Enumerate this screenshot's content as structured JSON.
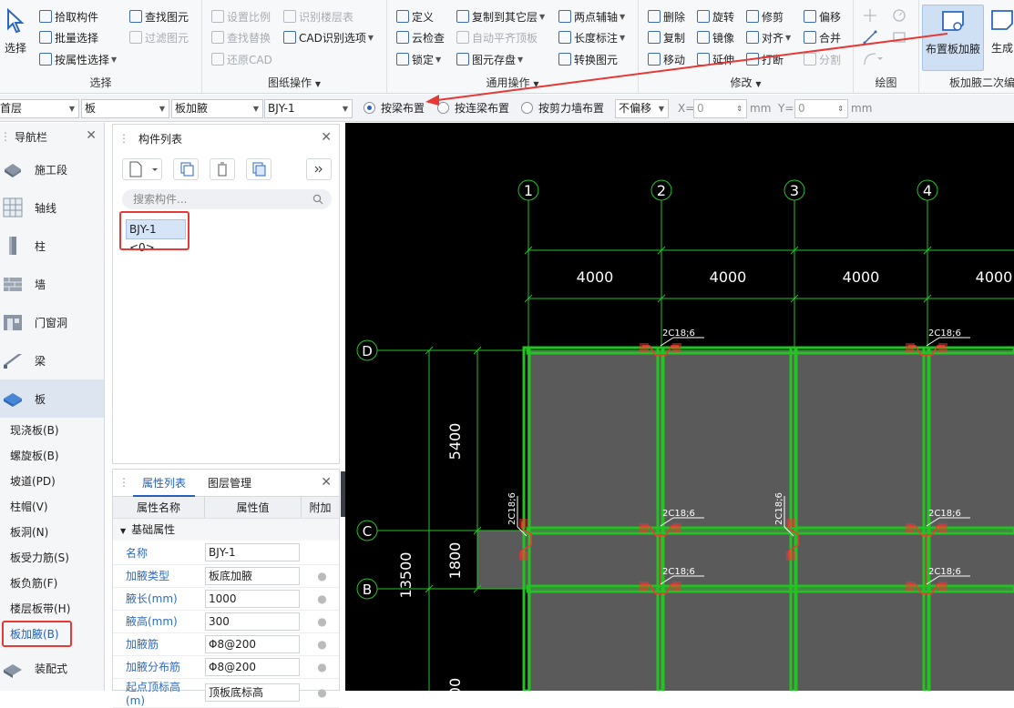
{
  "ribbon": {
    "select": {
      "label": "选择",
      "pick": "拾取构件",
      "batch": "批量选择",
      "by_attr": "按属性选择",
      "find": "查找图元",
      "filter": "过滤图元",
      "group": "选择"
    },
    "drawing_ops": {
      "set_scale": "设置比例",
      "recognize_floor_table": "识别楼层表",
      "find_replace": "查找替换",
      "cad_options": "CAD识别选项",
      "restore_cad": "还原CAD",
      "group": "图纸操作"
    },
    "general_ops": {
      "define": "定义",
      "copy_to_floor": "复制到其它层",
      "two_point_axis": "两点辅轴",
      "cloud_check": "云检查",
      "auto_align_slab": "自动平齐顶板",
      "length_dim": "长度标注",
      "lock": "锁定",
      "save_elements": "图元存盘",
      "convert_elements": "转换图元",
      "group": "通用操作"
    },
    "modify": {
      "delete": "删除",
      "rotate": "旋转",
      "trim": "修剪",
      "offset": "偏移",
      "copy": "复制",
      "mirror": "镜像",
      "align": "对齐",
      "merge": "合并",
      "move": "移动",
      "extend": "延伸",
      "break": "打断",
      "split": "分割",
      "group": "修改"
    },
    "draw": {
      "group": "绘图"
    },
    "haunch": {
      "place": "布置板加腋",
      "generate": "生成",
      "group": "板加腋二次编"
    }
  },
  "optbar": {
    "floor": "首层",
    "category": "板",
    "type": "板加腋",
    "element": "BJY-1",
    "radio1": "按梁布置",
    "radio2": "按连梁布置",
    "radio3": "按剪力墙布置",
    "offset": "不偏移",
    "x_label": "X=",
    "x_value": "0",
    "y_label": "Y=",
    "y_value": "0",
    "unit": "mm"
  },
  "nav": {
    "title": "导航栏",
    "items": [
      {
        "label": "施工段"
      },
      {
        "label": "轴线"
      },
      {
        "label": "柱"
      },
      {
        "label": "墙"
      },
      {
        "label": "门窗洞"
      },
      {
        "label": "梁"
      },
      {
        "label": "板"
      }
    ],
    "subitems": [
      "现浇板(B)",
      "螺旋板(B)",
      "坡道(PD)",
      "柱帽(V)",
      "板洞(N)",
      "板受力筋(S)",
      "板负筋(F)",
      "楼层板带(H)",
      "板加腋(B)"
    ],
    "bottom_item": "装配式"
  },
  "complist": {
    "title": "构件列表",
    "search_placeholder": "搜索构件...",
    "item": "BJY-1 <0>"
  },
  "props": {
    "tab1": "属性列表",
    "tab2": "图层管理",
    "col_name": "属性名称",
    "col_value": "属性值",
    "col_extra": "附加",
    "section": "基础属性",
    "rows": [
      {
        "name": "名称",
        "value": "BJY-1"
      },
      {
        "name": "加腋类型",
        "value": "板底加腋"
      },
      {
        "name": "腋长(mm)",
        "value": "1000"
      },
      {
        "name": "腋高(mm)",
        "value": "300"
      },
      {
        "name": "加腋筋",
        "value": "Φ8@200"
      },
      {
        "name": "加腋分布筋",
        "value": "Φ8@200"
      },
      {
        "name": "起点顶标高(m)",
        "value": "顶板底标高"
      }
    ]
  },
  "cad": {
    "axes_x": [
      "1",
      "2",
      "3",
      "4"
    ],
    "axes_y": [
      "D",
      "C",
      "B"
    ],
    "spans_x": [
      "4000",
      "4000",
      "4000",
      "4000"
    ],
    "span_y1": "5400",
    "span_y2": "1800",
    "total_y": "13500",
    "rebar_label": "2C18;6",
    "partial_dim": "00"
  },
  "colors": {
    "beam": "#22c322",
    "slab": "#5a5a5a",
    "rebar": "#ff3030",
    "highlight": "#e53935",
    "accent": "#2760b8"
  }
}
